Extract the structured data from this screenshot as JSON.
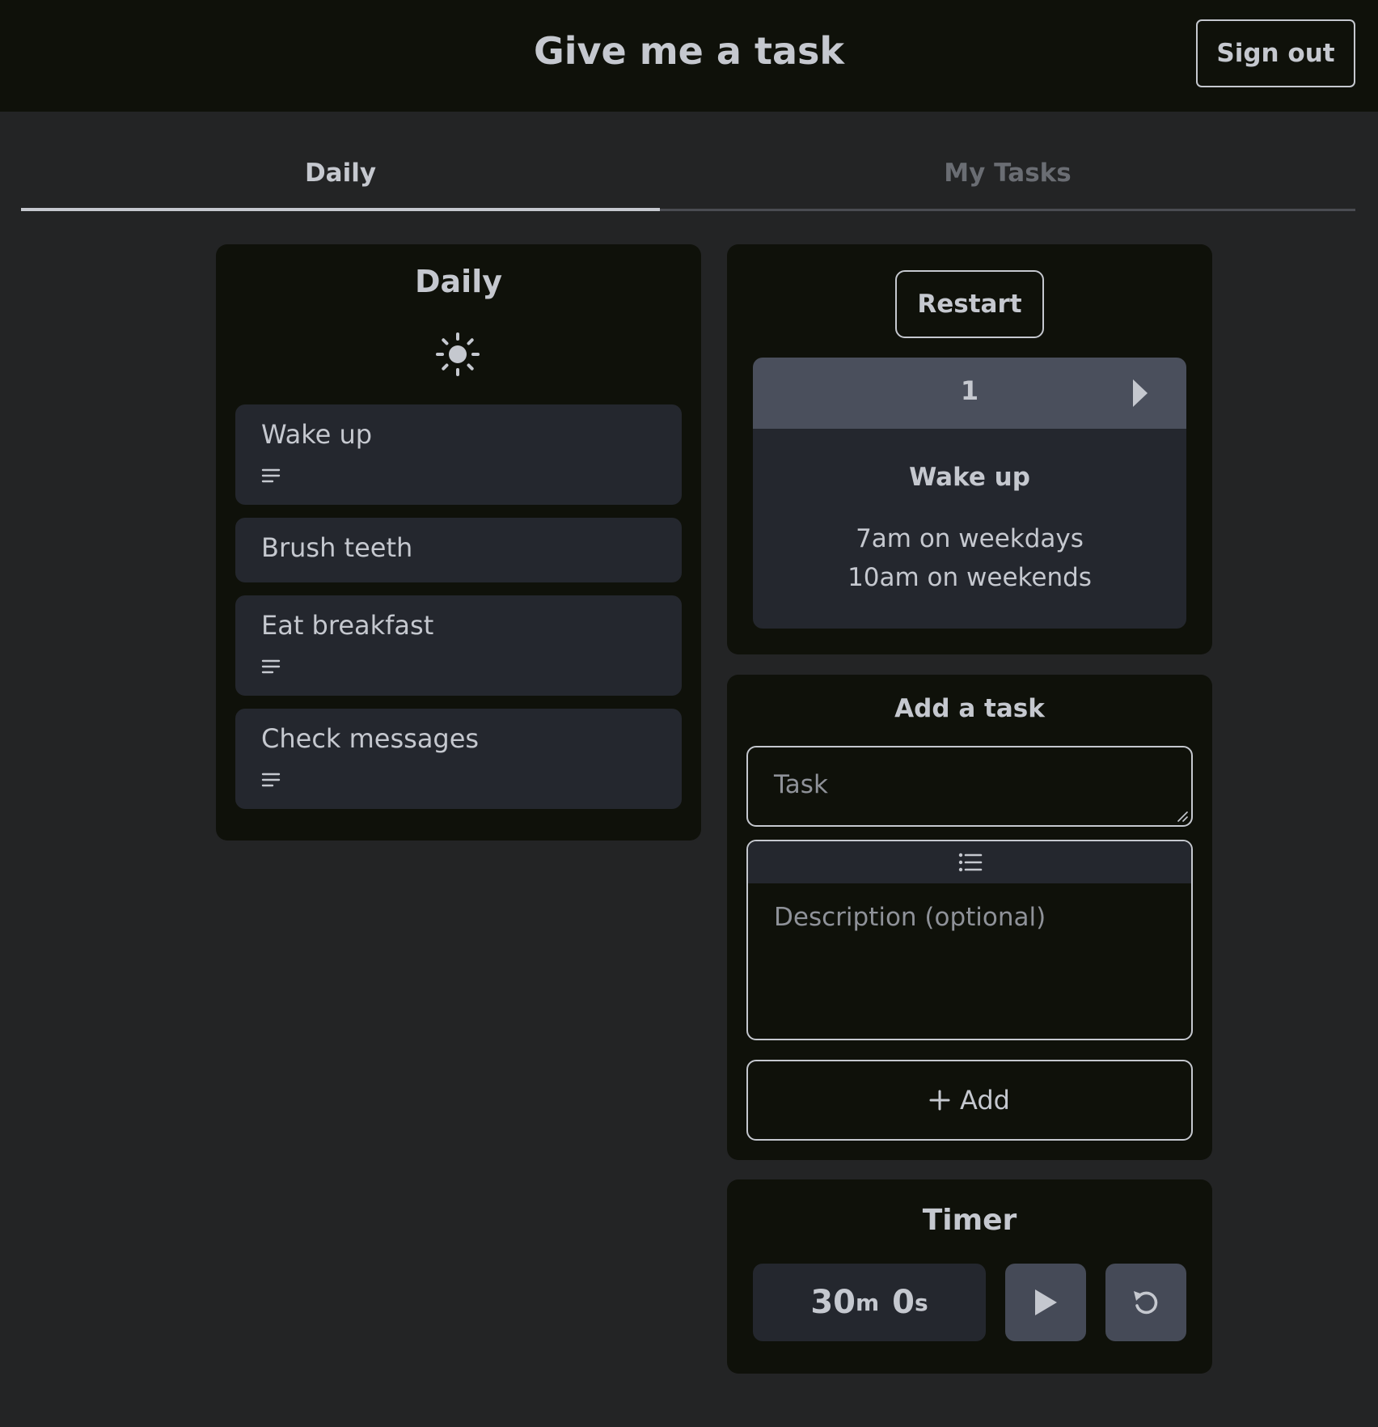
{
  "header": {
    "title": "Give me a task",
    "signout_label": "Sign out"
  },
  "tabs": [
    {
      "label": "Daily",
      "active": true
    },
    {
      "label": "My Tasks",
      "active": false
    }
  ],
  "daily": {
    "title": "Daily",
    "icon": "sun-icon",
    "items": [
      {
        "label": "Wake up",
        "has_description": true
      },
      {
        "label": "Brush teeth",
        "has_description": false
      },
      {
        "label": "Eat breakfast",
        "has_description": true
      },
      {
        "label": "Check messages",
        "has_description": true
      }
    ]
  },
  "current": {
    "restart_label": "Restart",
    "number": "1",
    "title": "Wake up",
    "description_lines": [
      "7am on weekdays",
      "10am on weekends"
    ]
  },
  "add_task": {
    "title": "Add a task",
    "task_placeholder": "Task",
    "task_value": "",
    "description_placeholder": "Description (optional)",
    "description_value": "",
    "add_label": "Add"
  },
  "timer": {
    "title": "Timer",
    "minutes": "30",
    "minutes_unit": "m",
    "seconds": "0",
    "seconds_unit": "s"
  },
  "colors": {
    "background": "#232425",
    "panel": "#0f110a",
    "card": "#24272e",
    "card_header": "#4a4f5c",
    "text": "#c5c8cf",
    "muted_tab": "#6a6d73",
    "button": "#454a57"
  }
}
